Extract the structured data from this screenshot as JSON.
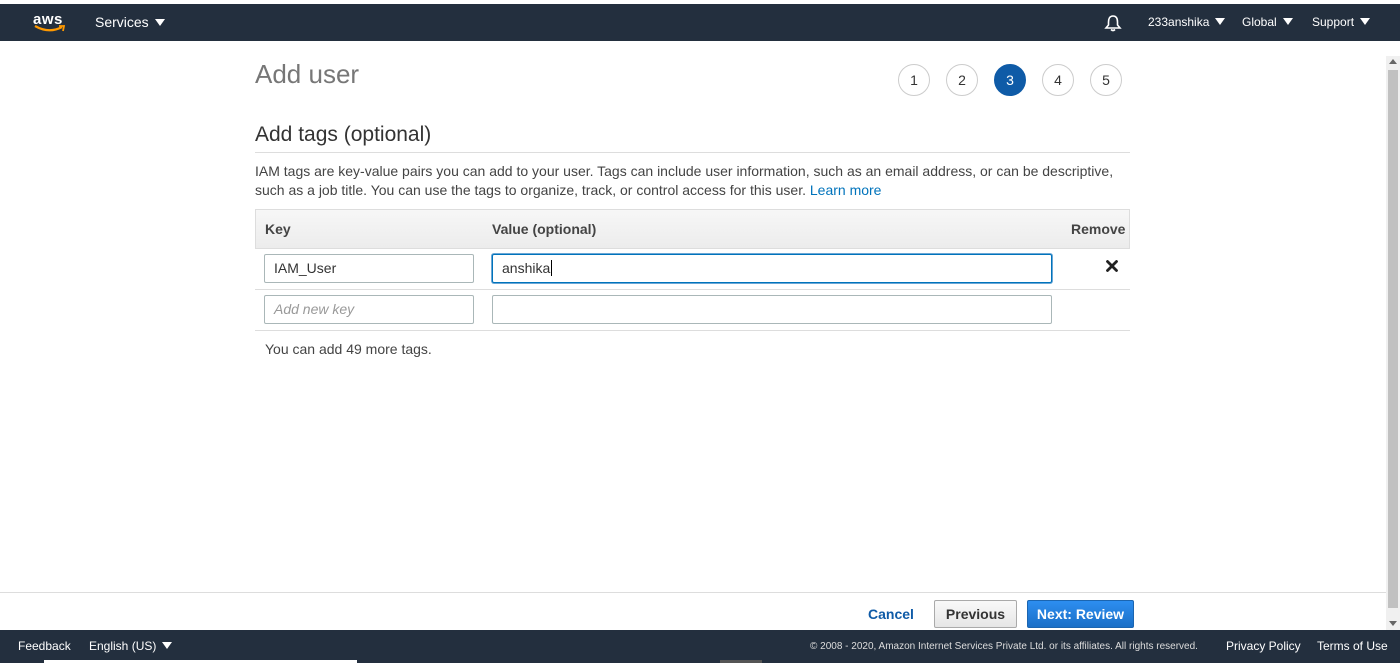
{
  "topbar": {
    "logo_text": "aws",
    "services_label": "Services",
    "account_label": "233anshika",
    "region_label": "Global",
    "support_label": "Support",
    "icons": {
      "logo": "aws-logo",
      "notifications": "bell-icon",
      "caret": "caret-down-icon"
    },
    "bg_color": "#232f3e"
  },
  "page": {
    "title": "Add user",
    "steps": [
      "1",
      "2",
      "3",
      "4",
      "5"
    ],
    "active_step": "3",
    "accent_color": "#0f5ba7"
  },
  "tags_section": {
    "title": "Add tags (optional)",
    "description": "IAM tags are key-value pairs you can add to your user. Tags can include user information, such as an email address, or can be descriptive, such as a job title. You can use the tags to organize, track, or control access for this user.",
    "learn_more_label": "Learn more",
    "columns": {
      "key": "Key",
      "value": "Value (optional)",
      "remove": "Remove"
    },
    "rows": [
      {
        "key": "IAM_User",
        "value": "anshika",
        "remove_icon": "close-icon"
      }
    ],
    "new_row": {
      "key_placeholder": "Add new key",
      "value_placeholder": ""
    },
    "remaining_text": "You can add 49 more tags."
  },
  "actions": {
    "cancel_label": "Cancel",
    "previous_label": "Previous",
    "next_label": "Next: Review"
  },
  "footer": {
    "feedback_label": "Feedback",
    "language_label": "English (US)",
    "copyright": "© 2008 - 2020, Amazon Internet Services Private Ltd. or its affiliates. All rights reserved.",
    "privacy_label": "Privacy Policy",
    "terms_label": "Terms of Use"
  }
}
